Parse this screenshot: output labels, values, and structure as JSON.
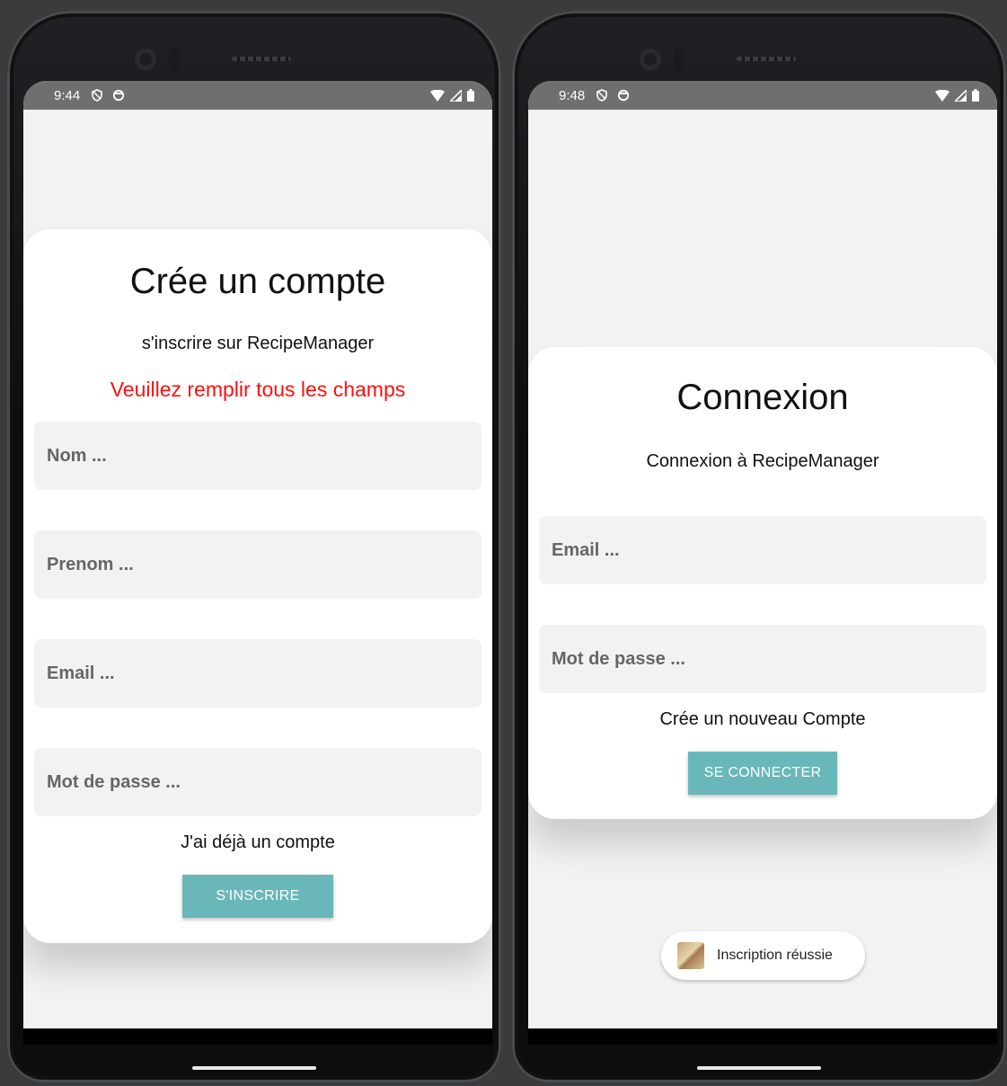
{
  "left_phone": {
    "status_time": "9:44",
    "title": "Crée un compte",
    "subtitle": "s'inscrire sur RecipeManager",
    "error_message": "Veuillez remplir tous les champs",
    "fields": {
      "nom_placeholder": "Nom ...",
      "prenom_placeholder": "Prenom ...",
      "email_placeholder": "Email ...",
      "password_placeholder": "Mot de passe ..."
    },
    "link_text": "J'ai déjà un compte",
    "button_label": "S'INSCRIRE"
  },
  "right_phone": {
    "status_time": "9:48",
    "title": "Connexion",
    "subtitle": "Connexion à RecipeManager",
    "fields": {
      "email_placeholder": "Email ...",
      "password_placeholder": "Mot de passe ..."
    },
    "link_text": "Crée un nouveau Compte",
    "button_label": "SE CONNECTER",
    "toast_text": "Inscription réussie"
  },
  "colors": {
    "accent": "#6ab7b9",
    "error": "#ff0f0f",
    "field_bg": "#f2f2f2",
    "status_bar": "#6f6f6f"
  },
  "icons": [
    "shield-icon",
    "circle-icon",
    "wifi-icon",
    "signal-icon",
    "battery-icon",
    "app-logo-icon"
  ]
}
